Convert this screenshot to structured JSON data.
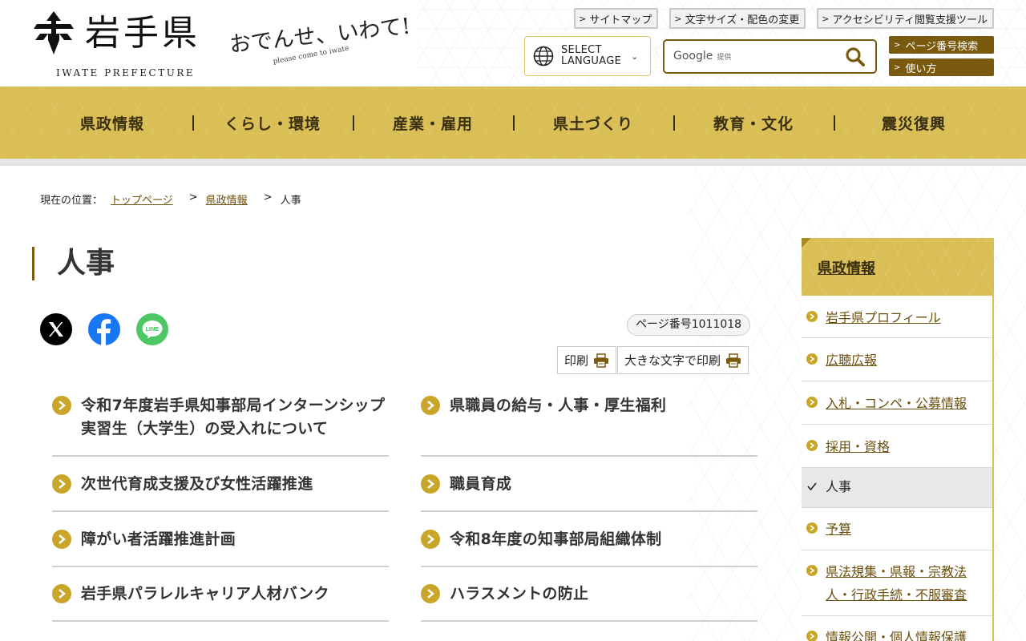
{
  "header": {
    "logo_name": "岩手県",
    "logo_en": "IWATE PREFECTURE",
    "catch_main": "おでんせ、いわて!",
    "catch_sub": "please come to iwate",
    "util_links": [
      "サイトマップ",
      "文字サイズ・配色の変更",
      "アクセシビリティ閲覧支援ツール"
    ],
    "language_label_1": "SELECT",
    "language_label_2": "LANGUAGE",
    "search_brand": "Google",
    "search_brand_suffix": "提供",
    "page_number_search": "ページ番号検索",
    "how_to_use": "使い方"
  },
  "nav": {
    "items": [
      "県政情報",
      "くらし・環境",
      "産業・雇用",
      "県土づくり",
      "教育・文化",
      "震災復興"
    ]
  },
  "breadcrumb": {
    "label": "現在の位置：",
    "items": [
      "トップページ",
      "県政情報",
      "人事"
    ]
  },
  "page": {
    "title": "人事",
    "page_number": "ページ番号1011018",
    "print": "印刷",
    "print_large": "大きな文字で印刷"
  },
  "links": [
    "令和7年度岩手県知事部局インターンシップ実習生（大学生）の受入れについて",
    "県職員の給与・人事・厚生福利",
    "次世代育成支援及び女性活躍推進",
    "職員育成",
    "障がい者活躍推進計画",
    "令和8年度の知事部局組織体制",
    "岩手県パラレルキャリア人材バンク",
    "ハラスメントの防止"
  ],
  "sidebar": {
    "heading": "県政情報",
    "items": [
      "岩手県プロフィール",
      "広聴広報",
      "入札・コンペ・公募情報",
      "採用・資格",
      "人事",
      "予算",
      "県法規集・県報・宗教法人・行政手続・不服審査",
      "情報公開・個人情報保護"
    ]
  },
  "colors": {
    "gold": "#d9bf55",
    "dark_gold": "#7a5a0e",
    "bullet": "#c9a52a"
  }
}
